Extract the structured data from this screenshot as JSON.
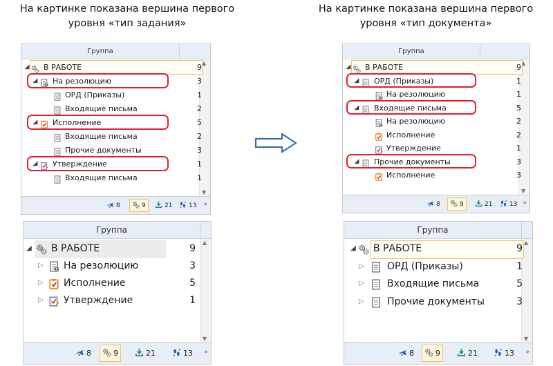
{
  "captions": {
    "left_line1": "На картинке показана вершина первого",
    "left_line2": "уровня «тип задания»",
    "right_line1": "На картинке показана вершина первого",
    "right_line2": "уровня «тип документа»"
  },
  "column_header": "Группа",
  "panel_tl": {
    "root": {
      "label": "В РАБОТЕ",
      "count": "9"
    },
    "rows": [
      {
        "label": "На резолюцию",
        "count": "3",
        "icon": "resolution-icon"
      },
      {
        "label": "ОРД (Приказы)",
        "count": "1",
        "icon": "document-icon"
      },
      {
        "label": "Входящие письма",
        "count": "2",
        "icon": "document-icon"
      },
      {
        "label": "Исполнение",
        "count": "5",
        "icon": "execution-icon"
      },
      {
        "label": "Входящие письма",
        "count": "2",
        "icon": "document-icon"
      },
      {
        "label": "Прочие документы",
        "count": "3",
        "icon": "document-icon"
      },
      {
        "label": "Утверждение",
        "count": "1",
        "icon": "approval-icon"
      },
      {
        "label": "Входящие письма",
        "count": "1",
        "icon": "document-icon"
      }
    ]
  },
  "panel_tr": {
    "root": {
      "label": "В РАБОТЕ",
      "count": "9"
    },
    "rows": [
      {
        "label": "ОРД (Приказы)",
        "count": "1",
        "icon": "document-icon"
      },
      {
        "label": "На резолюцию",
        "count": "1",
        "icon": "resolution-icon"
      },
      {
        "label": "Входящие письма",
        "count": "5",
        "icon": "document-icon"
      },
      {
        "label": "На резолюцию",
        "count": "2",
        "icon": "resolution-icon"
      },
      {
        "label": "Исполнение",
        "count": "2",
        "icon": "execution-icon"
      },
      {
        "label": "Утверждение",
        "count": "1",
        "icon": "approval-icon"
      },
      {
        "label": "Прочие документы",
        "count": "3",
        "icon": "document-icon"
      },
      {
        "label": "Исполнение",
        "count": "3",
        "icon": "execution-icon"
      }
    ]
  },
  "panel_bl": {
    "root": {
      "label": "В РАБОТЕ",
      "count": "9"
    },
    "rows": [
      {
        "label": "На резолюцию",
        "count": "3",
        "icon": "resolution-icon"
      },
      {
        "label": "Исполнение",
        "count": "5",
        "icon": "execution-icon"
      },
      {
        "label": "Утверждение",
        "count": "1",
        "icon": "approval-icon"
      }
    ]
  },
  "panel_br": {
    "root": {
      "label": "В РАБОТЕ",
      "count": "9"
    },
    "rows": [
      {
        "label": "ОРД (Приказы)",
        "count": "1",
        "icon": "document-icon"
      },
      {
        "label": "Входящие письма",
        "count": "5",
        "icon": "document-icon"
      },
      {
        "label": "Прочие документы",
        "count": "3",
        "icon": "document-icon"
      }
    ]
  },
  "footer": {
    "plane_count": "8",
    "gears_count": "9",
    "download_count": "21",
    "steps_count": "13",
    "more_label": "»"
  },
  "colors": {
    "highlight": "#e0202a",
    "header_bg": "#e7eef7",
    "selected_border": "#f0c36a",
    "icon_blue": "#2a5fa8",
    "icon_green": "#2f9a4f",
    "icon_orange": "#e08a1e"
  }
}
